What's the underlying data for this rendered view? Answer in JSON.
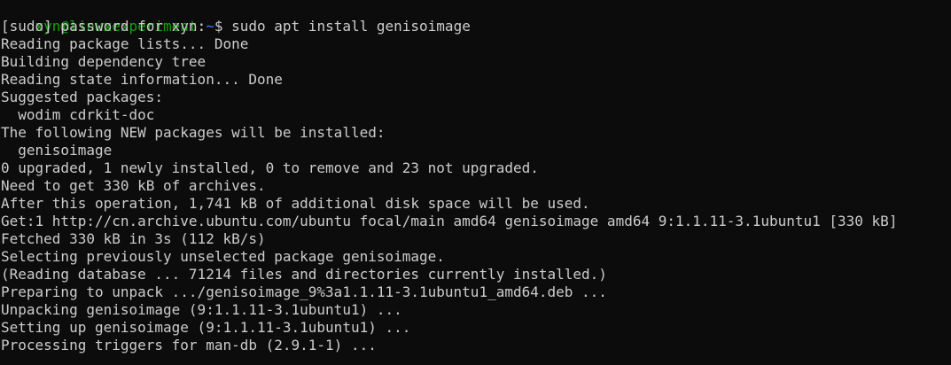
{
  "prompt": {
    "user_host": "xyn@linuxexperiment",
    "separator": ":",
    "path": "~",
    "symbol": "$ "
  },
  "command": "sudo apt install genisoimage",
  "output_lines": [
    "[sudo] password for xyn:",
    "Reading package lists... Done",
    "Building dependency tree",
    "Reading state information... Done",
    "Suggested packages:",
    "  wodim cdrkit-doc",
    "The following NEW packages will be installed:",
    "  genisoimage",
    "0 upgraded, 1 newly installed, 0 to remove and 23 not upgraded.",
    "Need to get 330 kB of archives.",
    "After this operation, 1,741 kB of additional disk space will be used.",
    "Get:1 http://cn.archive.ubuntu.com/ubuntu focal/main amd64 genisoimage amd64 9:1.1.11-3.1ubuntu1 [330 kB]",
    "Fetched 330 kB in 3s (112 kB/s)",
    "Selecting previously unselected package genisoimage.",
    "(Reading database ... 71214 files and directories currently installed.)",
    "Preparing to unpack .../genisoimage_9%3a1.1.11-3.1ubuntu1_amd64.deb ...",
    "Unpacking genisoimage (9:1.1.11-3.1ubuntu1) ...",
    "Setting up genisoimage (9:1.1.11-3.1ubuntu1) ...",
    "Processing triggers for man-db (2.9.1-1) ..."
  ],
  "colors": {
    "background": "#0c0c0c",
    "text": "#cccccc",
    "prompt_user": "#13a10e",
    "prompt_path": "#3b78ff"
  }
}
